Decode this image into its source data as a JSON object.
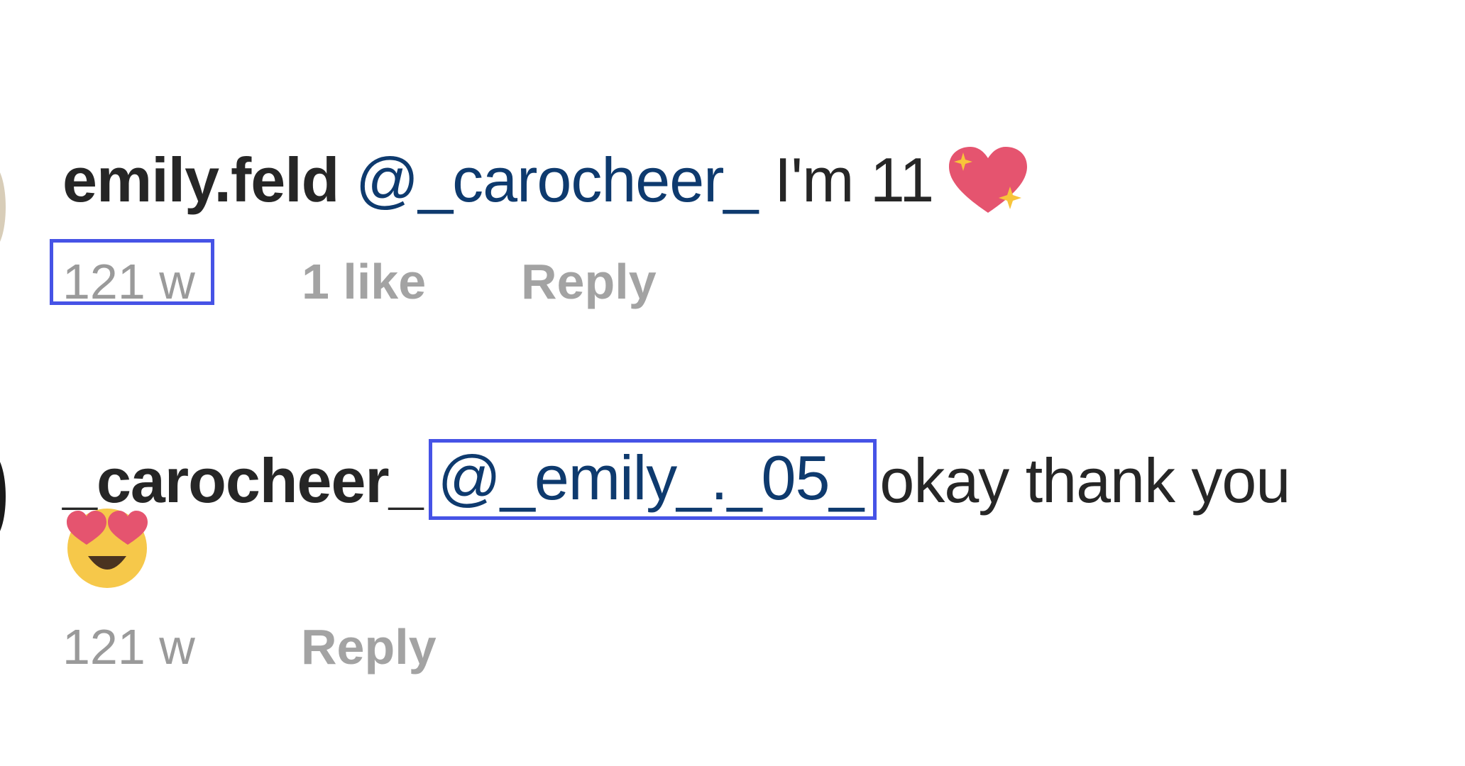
{
  "comments": [
    {
      "username": "emily.feld",
      "mention": "@_carocheer_",
      "text": "I'm 11",
      "emoji": "sparkling-heart-icon",
      "time": "121 w",
      "likes": "1 like",
      "reply": "Reply"
    },
    {
      "username": "_carocheer_",
      "mention": "@_emily_._05_",
      "text": "okay thank you",
      "emoji": "heart-eyes-face-icon",
      "time": "121 w",
      "reply": "Reply"
    }
  ],
  "colors": {
    "highlight_box": "#4653e6",
    "mention": "#0e3a6e",
    "text": "#262626",
    "meta": "#9a9a9a",
    "heart": "#e5546f",
    "sparkle": "#f8c43a",
    "face": "#f6c84a"
  }
}
